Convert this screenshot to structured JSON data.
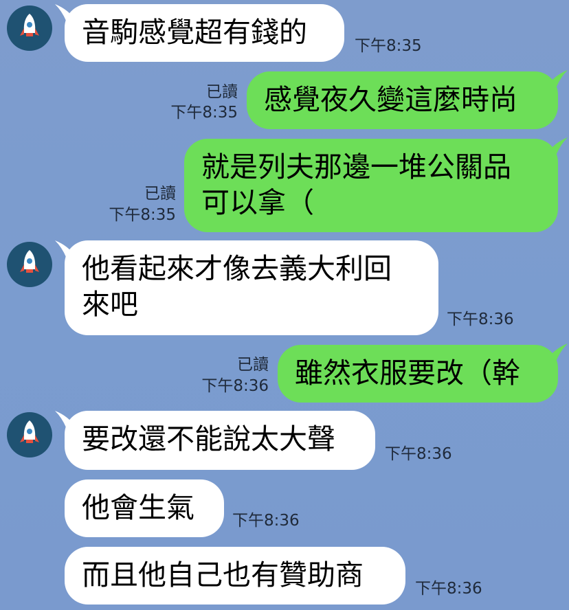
{
  "messages": [
    {
      "side": "in",
      "text": "音駒感覺超有錢的",
      "time": "下午8:35"
    },
    {
      "side": "out",
      "text": "感覺夜久變這麼時尚",
      "read": "已讀",
      "time": "下午8:35"
    },
    {
      "side": "out",
      "lines": [
        "就是列夫那邊一堆公關品",
        "可以拿（"
      ],
      "read": "已讀",
      "time": "下午8:35"
    },
    {
      "side": "in",
      "lines": [
        "他看起來才像去義大利回",
        "來吧"
      ],
      "time": "下午8:36"
    },
    {
      "side": "out",
      "text": "雖然衣服要改（幹",
      "read": "已讀",
      "time": "下午8:36"
    },
    {
      "side": "in",
      "text": "要改還不能說太大聲",
      "time": "下午8:36"
    },
    {
      "side": "in",
      "text": "他會生氣",
      "time": "下午8:36"
    },
    {
      "side": "in",
      "text": "而且他自己也有贊助商",
      "time": "下午8:36"
    }
  ],
  "avatar_icon": "rocket-icon",
  "colors": {
    "incoming": "#ffffff",
    "outgoing": "#6dde58",
    "background": "#7b9bce"
  }
}
